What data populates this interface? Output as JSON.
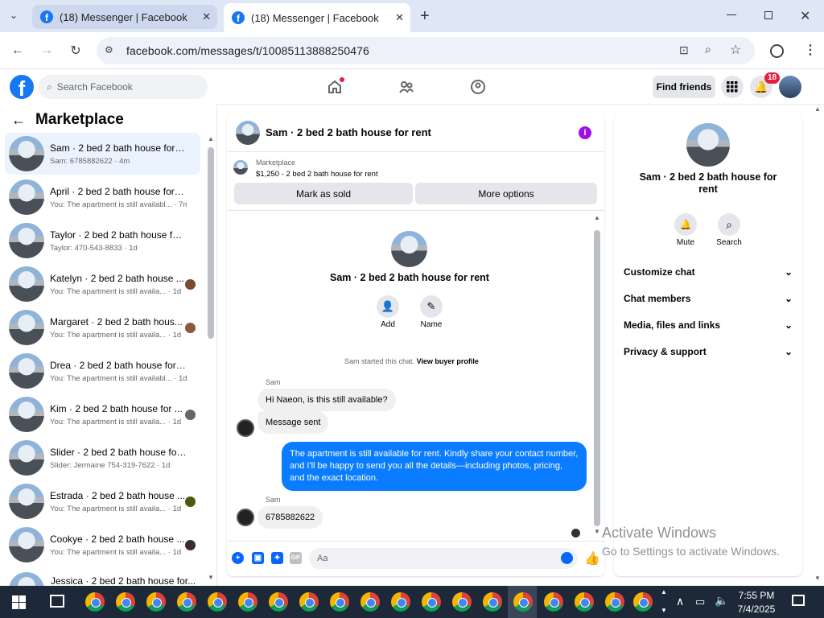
{
  "browser": {
    "tabs": [
      {
        "title": "(18) Messenger | Facebook"
      },
      {
        "title": "(18) Messenger | Facebook"
      }
    ],
    "new_tab_icon": "plus-icon",
    "url": "facebook.com/messages/t/10085113888250476"
  },
  "facebook": {
    "search_placeholder": "Search Facebook",
    "find_friends": "Find friends",
    "notification_count": "18"
  },
  "marketplace": {
    "title": "Marketplace",
    "conversations": [
      {
        "title": "Sam · 2 bed 2 bath house for rent",
        "preview": "Sam: 6785882622 · 4m",
        "active": true
      },
      {
        "title": "April · 2 bed 2 bath house for r...",
        "preview": "You: The apartment is still availabl... · 7m"
      },
      {
        "title": "Taylor · 2 bed 2 bath house for ...",
        "preview": "Taylor: 470-543-8833 · 1d"
      },
      {
        "title": "Katelyn · 2 bed 2 bath house ...",
        "preview": "You: The apartment is still availa... · 1d"
      },
      {
        "title": "Margaret · 2 bed 2 bath hous...",
        "preview": "You: The apartment is still availa... · 1d"
      },
      {
        "title": "Drea · 2 bed 2 bath house for r...",
        "preview": "You: The apartment is still availabl... · 1d"
      },
      {
        "title": "Kim · 2 bed 2 bath house for ...",
        "preview": "You: The apartment is still availa... · 1d"
      },
      {
        "title": "Slider · 2 bed 2 bath house for r...",
        "preview": "Slider: Jermaine 754-319-7622 · 1d"
      },
      {
        "title": "Estrada · 2 bed 2 bath house ...",
        "preview": "You: The apartment is still availa... · 1d"
      },
      {
        "title": "Cookye · 2 bed 2 bath house ...",
        "preview": "You: The apartment is still availa... · 1d"
      },
      {
        "title": "Jessica · 2 bed 2 bath house for...",
        "preview": ""
      }
    ]
  },
  "chat": {
    "title": "Sam · 2 bed 2 bath house for rent",
    "listing_label": "Marketplace",
    "listing_detail": "$1,250 - 2 bed 2 bath house for rent",
    "mark_sold": "Mark as sold",
    "more_options": "More options",
    "intro_title": "Sam · 2 bed 2 bath house for rent",
    "add_label": "Add",
    "name_label": "Name",
    "started_text": "Sam started this chat.",
    "buyer_profile": "View buyer profile",
    "messages": [
      {
        "sender": "Sam",
        "text": "Hi Naeon, is this still available?"
      },
      {
        "text": "Message sent"
      },
      {
        "text": "The apartment is still available for rent. Kindly share your contact number, and I'll be happy to send you all the details—including photos, pricing, and the exact location."
      },
      {
        "sender": "Sam",
        "text": "6785882622"
      }
    ],
    "composer_placeholder": "Aa",
    "gif_label": "GIF"
  },
  "details": {
    "title": "Sam · 2 bed 2 bath house for rent",
    "mute": "Mute",
    "search": "Search",
    "sections": [
      "Customize chat",
      "Chat members",
      "Media, files and links",
      "Privacy & support"
    ]
  },
  "watermark": {
    "line1": "Activate Windows",
    "line2": "Go to Settings to activate Windows."
  },
  "taskbar": {
    "time": "7:55 PM",
    "date": "7/4/2025"
  }
}
